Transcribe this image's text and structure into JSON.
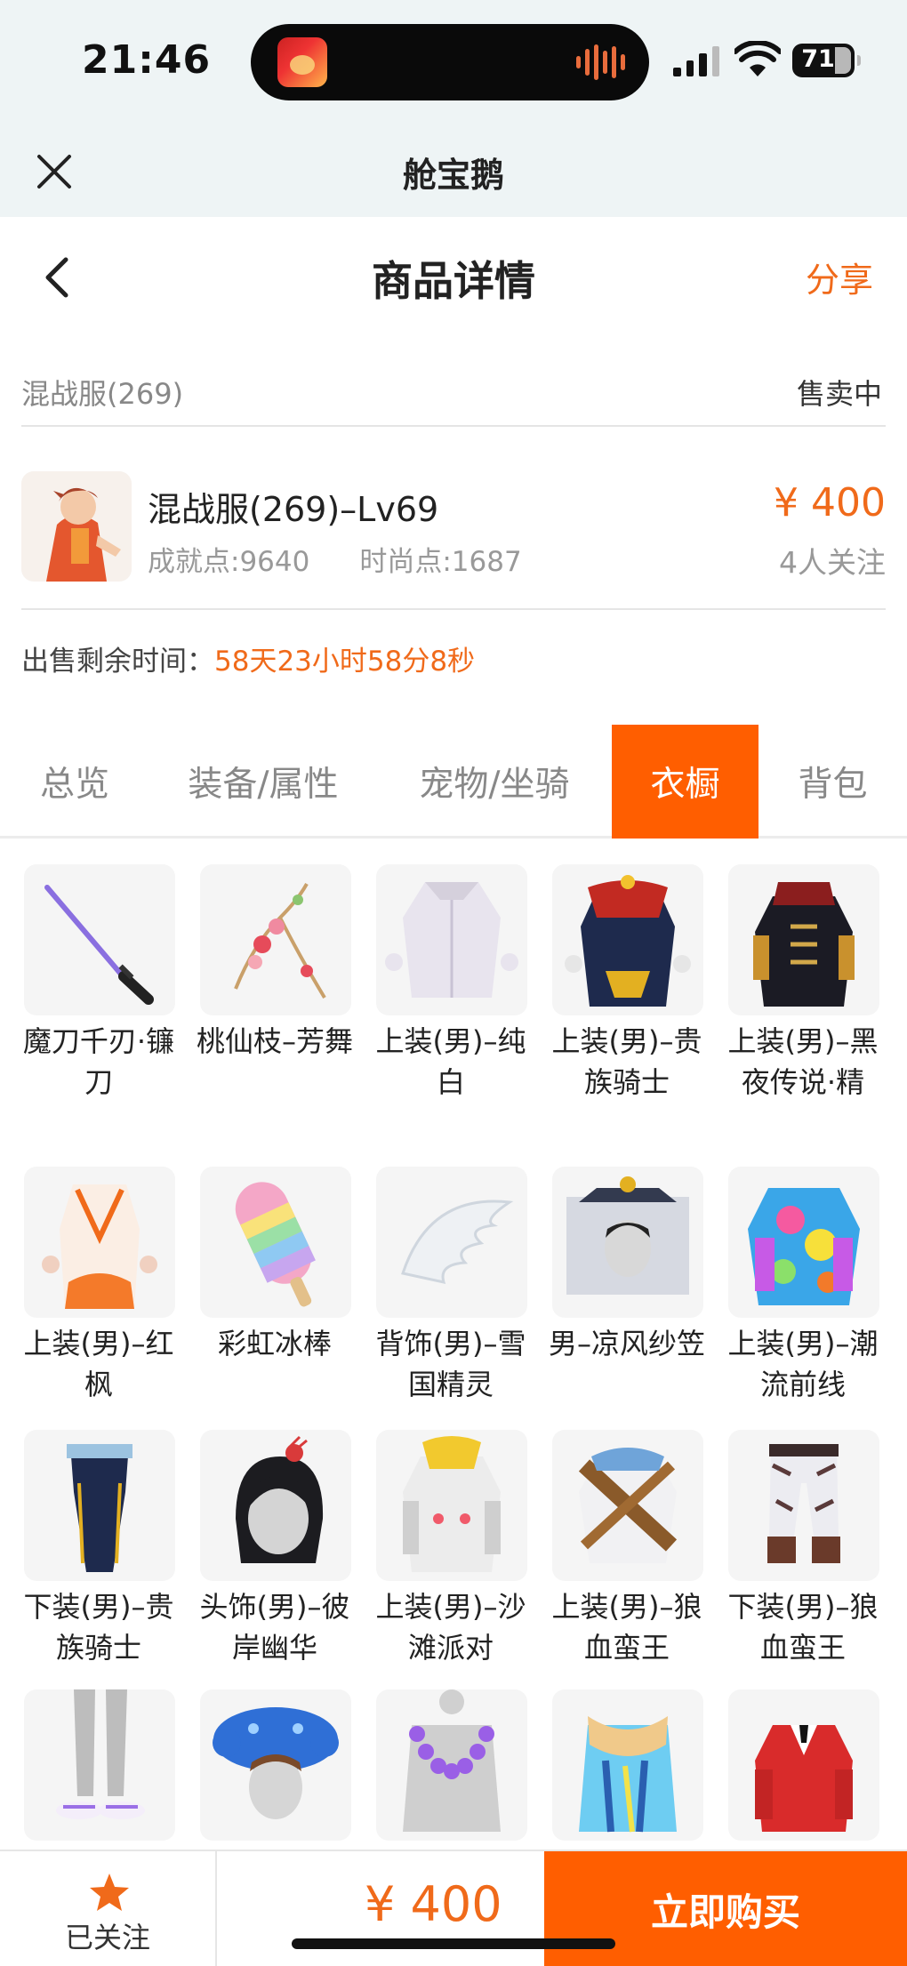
{
  "status": {
    "time": "21:46",
    "battery": "71"
  },
  "appbar": {
    "title": "舱宝鹅"
  },
  "nav": {
    "title": "商品详情",
    "share": "分享"
  },
  "server": {
    "name": "混战服(269)",
    "status": "售卖中"
  },
  "product": {
    "title": "混战服(269)–Lv69",
    "achievement": "成就点:9640",
    "fashion": "时尚点:1687",
    "price": "¥ 400",
    "followers": "4人关注"
  },
  "remain": {
    "label": "出售剩余时间：",
    "value": "58天23小时58分8秒"
  },
  "tabs": [
    {
      "label": "总览",
      "active": false
    },
    {
      "label": "装备/属性",
      "active": false
    },
    {
      "label": "宠物/坐骑",
      "active": false
    },
    {
      "label": "衣橱",
      "active": true
    },
    {
      "label": "背包",
      "active": false
    }
  ],
  "items": [
    {
      "label": "魔刀千刃·镰刀",
      "icon": "katana-icon"
    },
    {
      "label": "桃仙枝–芳舞",
      "icon": "blossom-branch-icon"
    },
    {
      "label": "上装(男)–纯白",
      "icon": "white-coat-icon"
    },
    {
      "label": "上装(男)–贵族骑士",
      "icon": "knight-coat-icon"
    },
    {
      "label": "上装(男)–黑夜传说·精",
      "icon": "dark-coat-icon"
    },
    {
      "label": "上装(男)–红枫",
      "icon": "maple-robe-icon"
    },
    {
      "label": "彩虹冰棒",
      "icon": "rainbow-popsicle-icon"
    },
    {
      "label": "背饰(男)–雪国精灵",
      "icon": "wings-icon"
    },
    {
      "label": "男–凉风纱笠",
      "icon": "veil-hat-icon"
    },
    {
      "label": "上装(男)–潮流前线",
      "icon": "colorful-jacket-icon"
    },
    {
      "label": "下装(男)–贵族骑士",
      "icon": "knight-pants-icon"
    },
    {
      "label": "头饰(男)–彼岸幽华",
      "icon": "hair-flower-icon"
    },
    {
      "label": "上装(男)–沙滩派对",
      "icon": "beach-hoodie-icon"
    },
    {
      "label": "上装(男)–狼血蛮王",
      "icon": "warrior-top-icon"
    },
    {
      "label": "下装(男)–狼血蛮王",
      "icon": "fur-pants-icon"
    },
    {
      "label": "",
      "icon": "sandals-icon"
    },
    {
      "label": "",
      "icon": "octopus-hat-icon"
    },
    {
      "label": "",
      "icon": "flower-lei-icon"
    },
    {
      "label": "",
      "icon": "sash-outfit-icon"
    },
    {
      "label": "",
      "icon": "red-jacket-icon"
    }
  ],
  "bottom": {
    "follow_label": "已关注",
    "price": "¥ 400",
    "buy_label": "立即购买"
  },
  "colors": {
    "accent": "#ff5e00",
    "price": "#f06a1a",
    "statusbar": "#eef4f5"
  }
}
